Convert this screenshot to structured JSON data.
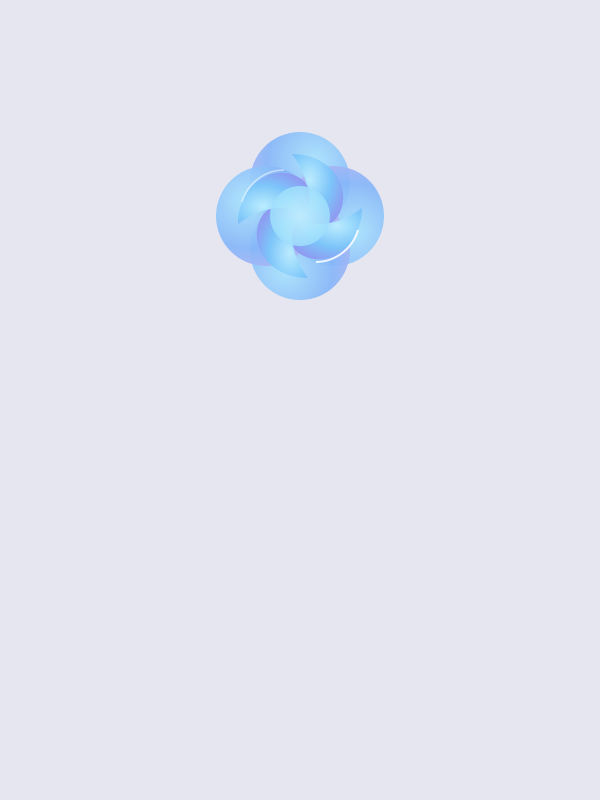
{
  "screen": {
    "background_color": "#E6E6F0"
  },
  "logo": {
    "icon": "pinwheel-swirl-logo-icon",
    "colors": {
      "light_cyan": "#BDEFFF",
      "sky_blue": "#7CC6FA",
      "periwinkle": "#8F96F0",
      "lavender": "#B7B4F4"
    }
  }
}
